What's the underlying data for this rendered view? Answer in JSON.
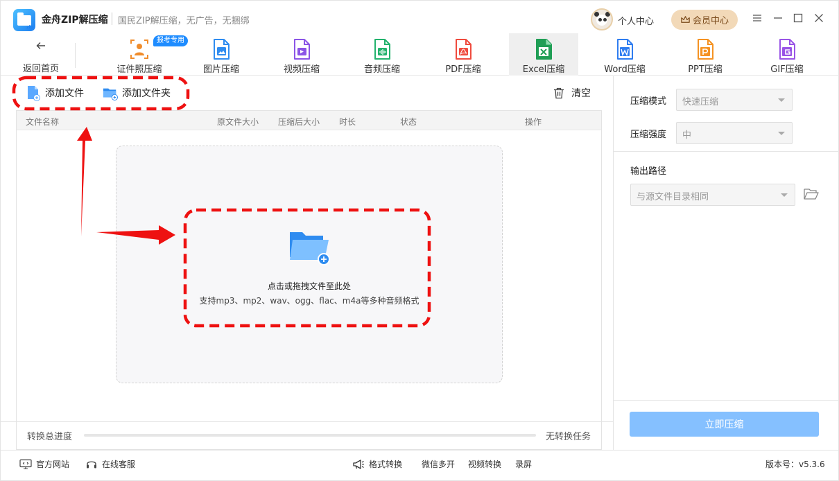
{
  "titlebar": {
    "app_name": "金舟ZIP解压缩",
    "slogan": "国民ZIP解压缩，无广告，无捆绑",
    "personal_center": "个人中心",
    "vip_center": "会员中心"
  },
  "toolbar": {
    "back_label": "返回首页",
    "badge": "报考专用",
    "tools": [
      {
        "label": "证件照压缩",
        "icon": "id-photo-icon",
        "color": "#f08c2b"
      },
      {
        "label": "图片压缩",
        "icon": "image-file-icon",
        "color": "#2f8cf0"
      },
      {
        "label": "视频压缩",
        "icon": "video-file-icon",
        "color": "#8b55e6"
      },
      {
        "label": "音频压缩",
        "icon": "audio-file-icon",
        "color": "#23b26d"
      },
      {
        "label": "PDF压缩",
        "icon": "pdf-file-icon",
        "color": "#ef4b3e"
      },
      {
        "label": "Excel压缩",
        "icon": "excel-file-icon",
        "color": "#1f9e55",
        "active": true
      },
      {
        "label": "Word压缩",
        "icon": "word-file-icon",
        "color": "#2f7df0"
      },
      {
        "label": "PPT压缩",
        "icon": "ppt-file-icon",
        "color": "#f59323"
      },
      {
        "label": "GIF压缩",
        "icon": "gif-file-icon",
        "color": "#9a55e6"
      }
    ]
  },
  "files": {
    "add_file": "添加文件",
    "add_folder": "添加文件夹",
    "clear": "清空",
    "columns": [
      "文件名称",
      "原文件大小",
      "压缩后大小",
      "时长",
      "状态",
      "操作"
    ],
    "drop_title": "点击或拖拽文件至此处",
    "drop_hint": "支持mp3、mp2、wav、ogg、flac、m4a等多种音频格式"
  },
  "progress": {
    "label": "转换总进度",
    "value": 0,
    "status": "无转换任务"
  },
  "settings": {
    "mode_label": "压缩模式",
    "mode_value": "快速压缩",
    "strength_label": "压缩强度",
    "strength_value": "中",
    "output_label": "输出路径",
    "output_value": "与源文件目录相同",
    "compress_button": "立即压缩"
  },
  "footer": {
    "website": "官方网站",
    "support": "在线客服",
    "format_convert": "格式转换",
    "wechat_multi": "微信多开",
    "video_convert": "视频转换",
    "record": "录屏",
    "version": "版本号：v5.3.6"
  },
  "colors": {
    "accent": "#3b8cff",
    "compress_button": "#85c0ff",
    "annotation_red": "#ee1111",
    "vip_bg": "#f2d9b8"
  }
}
